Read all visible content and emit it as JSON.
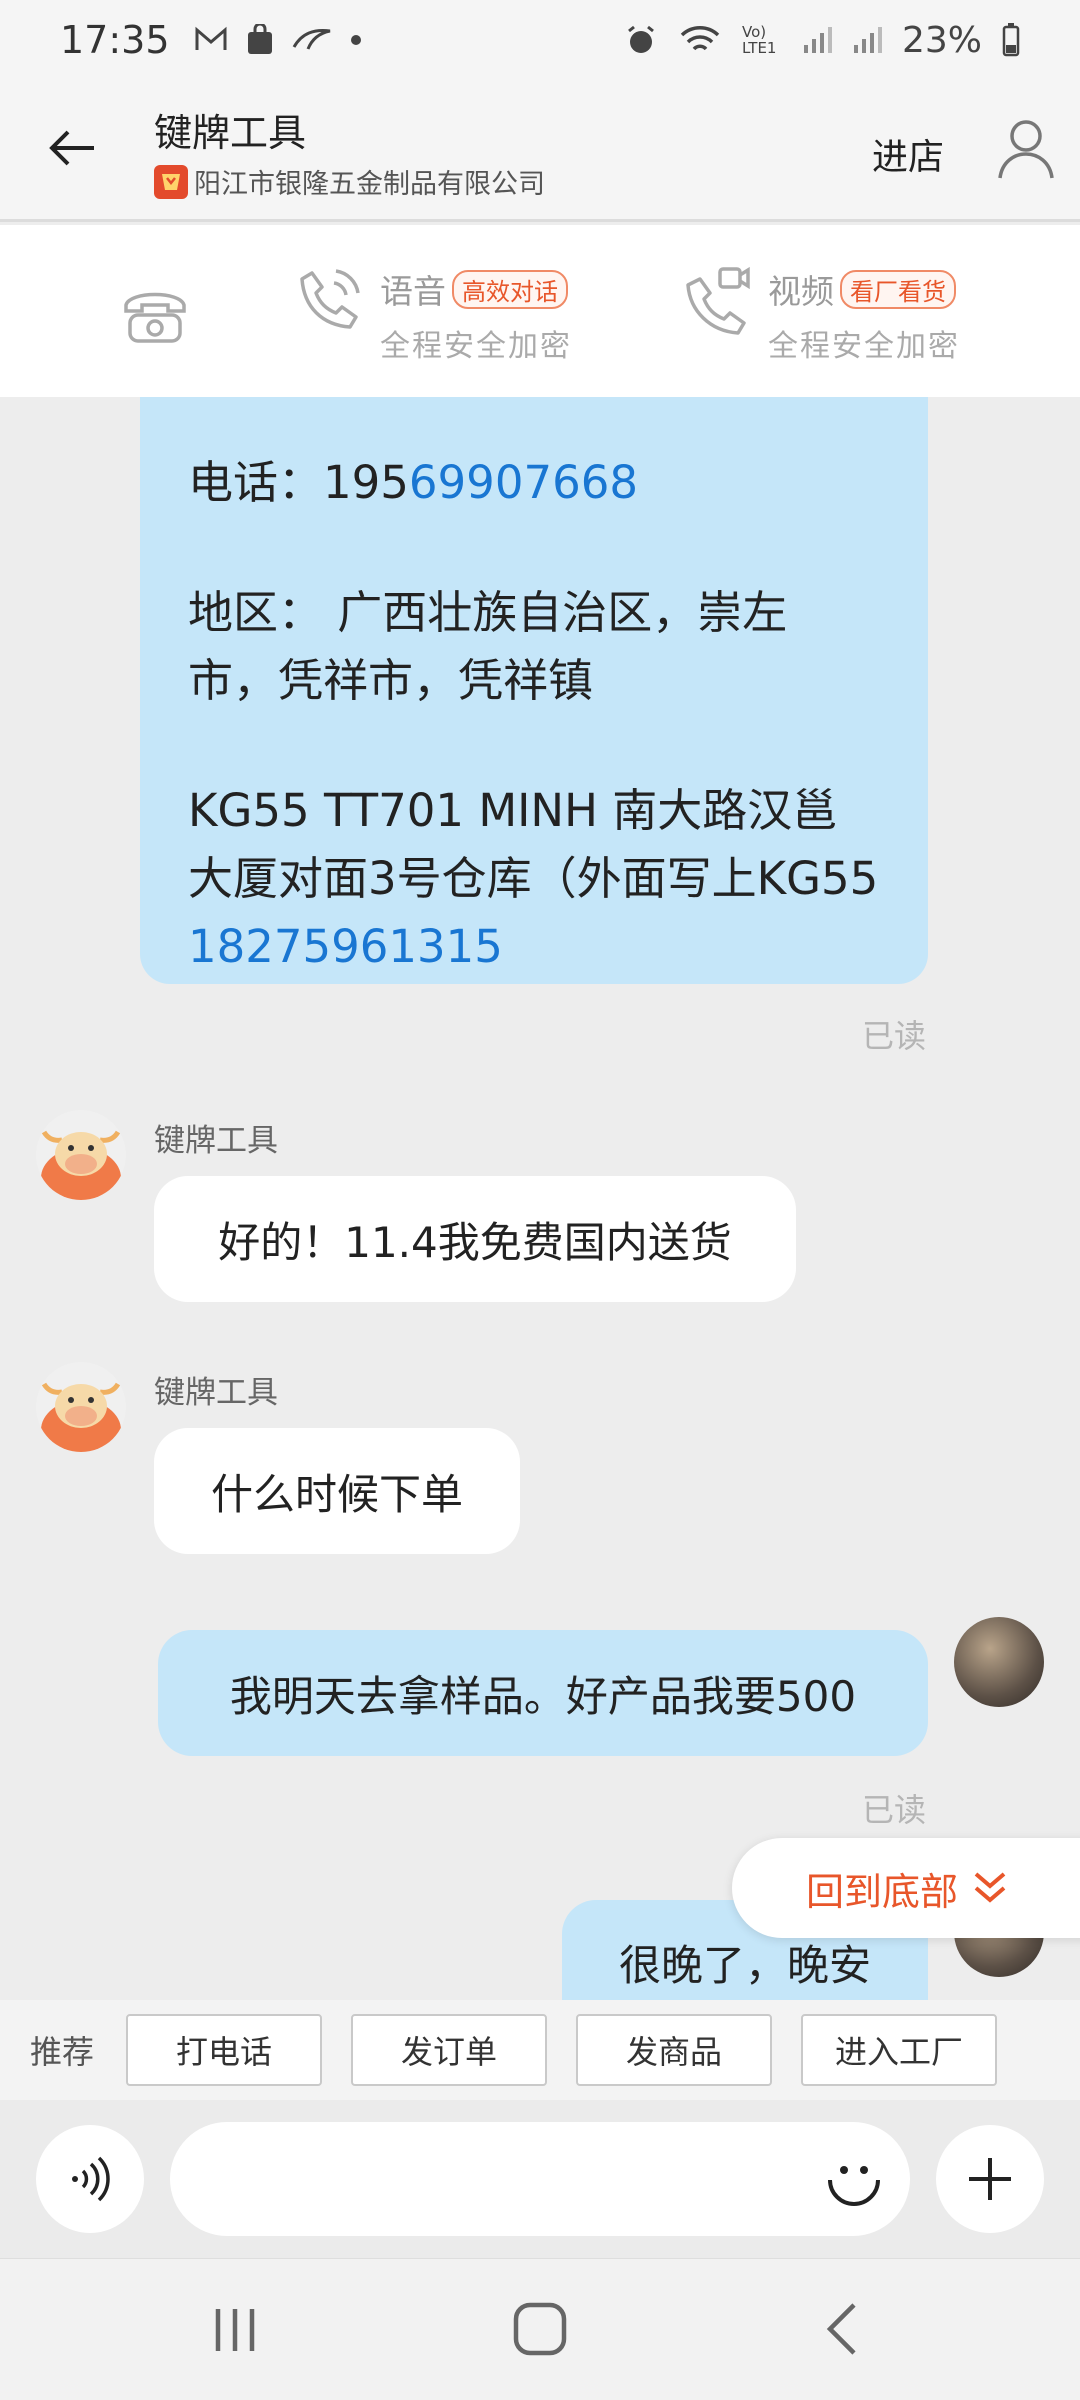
{
  "status_bar": {
    "time": "17:35",
    "left_icons": [
      "mail-icon",
      "shopping-bag-icon",
      "bird-logo-icon",
      "dot-icon"
    ],
    "right_icons": [
      "alarm-icon",
      "wifi-icon",
      "volte-icon",
      "signal-icon",
      "signal-icon"
    ],
    "volte_text": "Vo) LTE1",
    "battery": "23%"
  },
  "header": {
    "title": "键牌工具",
    "subtitle": "阳江市银隆五金制品有限公司",
    "enter_shop": "进店"
  },
  "call_bar": {
    "voice": {
      "label": "语音",
      "tag": "高效对话",
      "sub": "全程安全加密"
    },
    "video": {
      "label": "视频",
      "tag": "看厂看货",
      "sub": "全程安全加密"
    }
  },
  "messages": {
    "address": {
      "phone_label": "电话：",
      "phone_plain": "195",
      "phone_link": "69907668",
      "region_line1": "地区： 广西壮族自治区，崇左",
      "region_line2": "市，凭祥市，凭祥镇",
      "addr_line1": "KG55 TT701 MINH  南大路汉邕",
      "addr_line2": "大厦对面3号仓库（外面写上KG55",
      "addr_link": "18275961315",
      "read": "已读"
    },
    "m1": {
      "sender": "键牌工具",
      "text": "好的！11.4我免费国内送货"
    },
    "m2": {
      "sender": "键牌工具",
      "text": "什么时候下单"
    },
    "m3": {
      "text": "我明天去拿样品。好产品我要500",
      "read": "已读"
    },
    "m4": {
      "text": "很晚了，晚安"
    }
  },
  "to_bottom": {
    "label": "回到底部"
  },
  "recommend": {
    "label": "推荐",
    "buttons": [
      "打电话",
      "发订单",
      "发商品",
      "进入工厂"
    ]
  },
  "input": {
    "placeholder": ""
  },
  "nav": {
    "icons": [
      "recent-apps-icon",
      "home-icon",
      "back-icon"
    ]
  },
  "colors": {
    "accent": "#e8562a",
    "link": "#1976d2",
    "bubble_blue": "#c5e6f9"
  }
}
